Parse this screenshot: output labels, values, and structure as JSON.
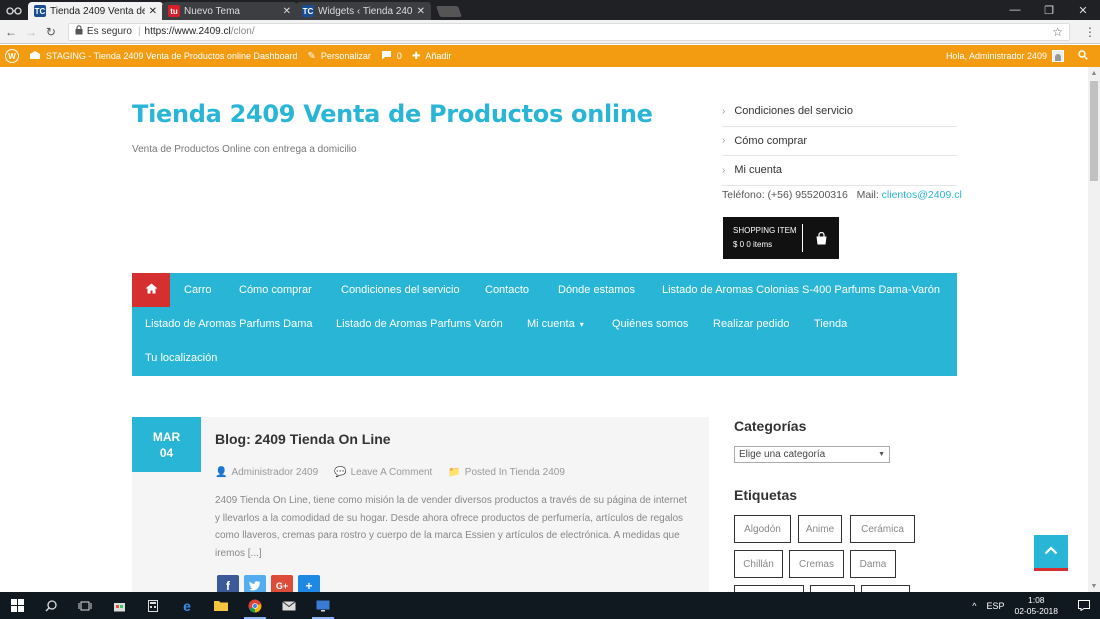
{
  "browser": {
    "tabs": [
      {
        "title": "Tienda 2409 Venta de Pr",
        "favicon": "tc-logo",
        "active": true
      },
      {
        "title": "Nuevo Tema",
        "favicon": "tm-logo",
        "active": false
      },
      {
        "title": "Widgets ‹ Tienda 2409 V",
        "favicon": "tc-logo",
        "active": false
      }
    ],
    "security_label": "Es seguro",
    "url_host": "https://www.2409.cl",
    "url_path": "/clon/"
  },
  "adminbar": {
    "site_name": "STAGING - Tienda 2409 Venta de Productos online Dashboard",
    "customize": "Personalizar",
    "comments_count": "0",
    "add_new": "Añadir",
    "greeting": "Hola, Administrador 2409"
  },
  "site": {
    "title": "Tienda 2409 Venta de Productos online",
    "tagline": "Venta de Productos Online con entrega a domicilio",
    "top_menu": [
      "Condiciones del servicio",
      "Cómo comprar",
      "Mi cuenta"
    ],
    "phone_text": "Teléfono: (+56) 955200316",
    "mail_label": "Mail:",
    "mail": "clientos@2409.cl",
    "cart": {
      "label": "SHOPPING ITEM",
      "summary": "$ 0 0 items"
    }
  },
  "nav": {
    "items": [
      "Carro",
      "Cómo comprar",
      "Condiciones del servicio",
      "Contacto",
      "Dónde estamos",
      "Listado de Aromas Colonias S-400 Parfums Dama-Varón",
      "Listado de Aromas Parfums Dama",
      "Listado de Aromas Parfums Varón",
      "Mi cuenta",
      "Quiénes somos",
      "Realizar pedido",
      "Tienda",
      "Tu localización"
    ]
  },
  "post": {
    "month": "MAR",
    "day": "04",
    "title": "Blog: 2409 Tienda On Line",
    "author": "Administrador 2409",
    "comment": "Leave A Comment",
    "category": "Posted In Tienda 2409",
    "excerpt": "2409 Tienda On Line, tiene como misión la de vender diversos productos a través de su página de internet y llevarlos a la comodidad de su hogar. Desde ahora ofrece productos de perfumería, artículos de regalos como llaveros, cremas para rostro y cuerpo de la marca Essien y artículos de electrónica. A medidas que iremos [...]"
  },
  "sidebar": {
    "categories_title": "Categorías",
    "categories_select": "Elige una categoría",
    "tags_title": "Etiquetas",
    "tags": [
      "Algodón",
      "Anime",
      "Cerámica",
      "Chillán",
      "Cremas",
      "Dama"
    ]
  },
  "taskbar": {
    "lang": "ESP",
    "time": "1:08",
    "date": "02-05-2018"
  },
  "colors": {
    "accent": "#29b6d6",
    "admin_bar": "#f39c12",
    "home_button": "#d62f2f"
  }
}
